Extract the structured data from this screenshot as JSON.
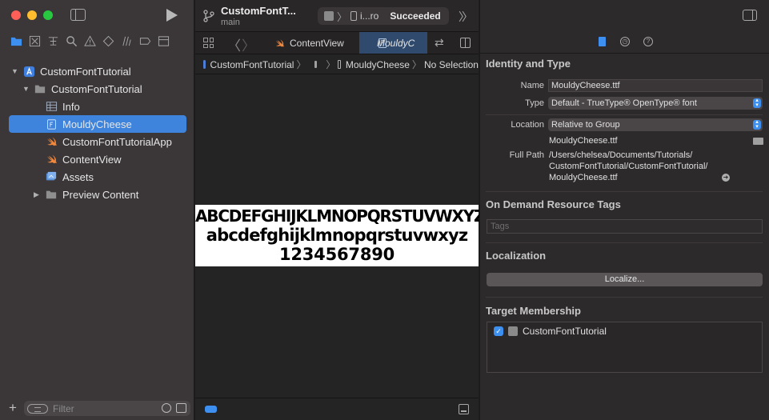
{
  "navigator": {
    "tree": [
      {
        "label": "CustomFontTutorial",
        "kind": "project",
        "icon": "project-icon",
        "expanded": true
      },
      {
        "label": "CustomFontTutorial",
        "kind": "group",
        "icon": "folder-icon",
        "expanded": true
      },
      {
        "label": "Info",
        "kind": "file",
        "icon": "plist-icon"
      },
      {
        "label": "MouldyCheese",
        "kind": "file",
        "icon": "font-file-icon",
        "selected": true
      },
      {
        "label": "CustomFontTutorialApp",
        "kind": "file",
        "icon": "swift-icon"
      },
      {
        "label": "ContentView",
        "kind": "file",
        "icon": "swift-icon"
      },
      {
        "label": "Assets",
        "kind": "file",
        "icon": "assets-icon"
      },
      {
        "label": "Preview Content",
        "kind": "group",
        "icon": "folder-icon",
        "expanded": false
      }
    ],
    "filter_placeholder": "Filter"
  },
  "toolbar": {
    "project_title": "CustomFontT...",
    "branch": "main",
    "device": "i...ro",
    "status": "Succeeded"
  },
  "tabs": [
    {
      "label": "ContentView"
    },
    {
      "label": "MouldyC",
      "active": true
    }
  ],
  "jumpbar": {
    "project": "CustomFontTutorial",
    "file": "MouldyCheese",
    "selection": "No Selection"
  },
  "font_preview": {
    "uppercase": "ABCDEFGHIJKLMNOPQRSTUVWXYZ",
    "lowercase": "abcdefghijklmnopqrstuvwxyz",
    "digits": "1234567890"
  },
  "inspector": {
    "identity": {
      "title": "Identity and Type",
      "name_label": "Name",
      "name_value": "MouldyCheese.ttf",
      "type_label": "Type",
      "type_value": "Default - TrueType® OpenType® font",
      "location_label": "Location",
      "location_value": "Relative to Group",
      "location_file": "MouldyCheese.ttf",
      "fullpath_label": "Full Path",
      "fullpath_line1": "/Users/chelsea/Documents/Tutorials/",
      "fullpath_line2": "CustomFontTutorial/CustomFontTutorial/",
      "fullpath_line3": "MouldyCheese.ttf"
    },
    "odr": {
      "title": "On Demand Resource Tags",
      "tags_placeholder": "Tags"
    },
    "localization": {
      "title": "Localization",
      "button": "Localize..."
    },
    "target": {
      "title": "Target Membership",
      "item": "CustomFontTutorial",
      "checked": true
    }
  },
  "colors": {
    "accent": "#3d8ff0",
    "selection": "#3f84dc"
  }
}
